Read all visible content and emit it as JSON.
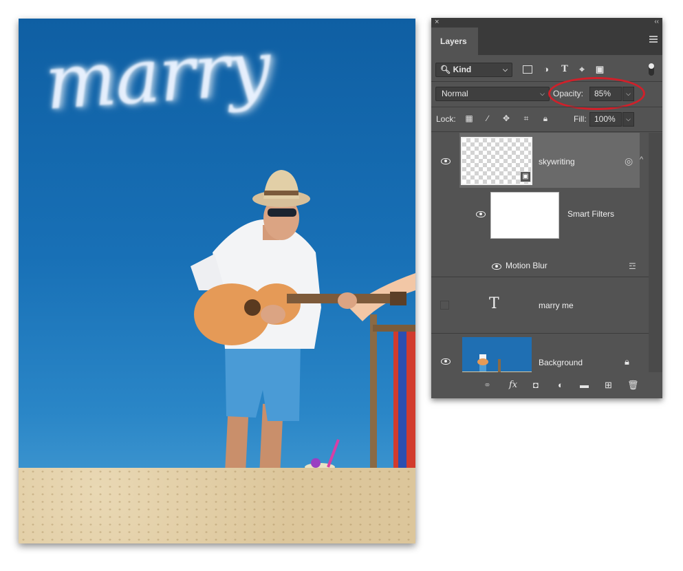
{
  "canvas": {
    "skywriting_text": "marry"
  },
  "panel": {
    "close_glyph": "×",
    "collapse_glyph": "‹‹",
    "tab": "Layers",
    "filter": {
      "kind_label": "Kind"
    },
    "blend_mode": "Normal",
    "opacity_label": "Opacity:",
    "opacity_value": "85%",
    "lock_label": "Lock:",
    "fill_label": "Fill:",
    "fill_value": "100%",
    "layers": [
      {
        "name": "skywriting",
        "visible": true,
        "selected": true,
        "type": "smart-object"
      },
      {
        "name": "Smart Filters",
        "visible": true,
        "type": "smart-filters"
      },
      {
        "name": "Motion Blur",
        "visible": true,
        "type": "filter"
      },
      {
        "name": "marry me",
        "visible": false,
        "type": "text",
        "glyph": "T"
      },
      {
        "name": "Background",
        "visible": true,
        "type": "image",
        "locked": true
      }
    ]
  },
  "highlight_color": "#d0202a"
}
